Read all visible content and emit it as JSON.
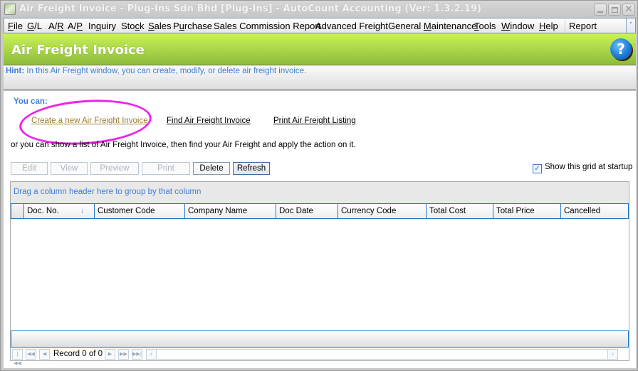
{
  "window": {
    "title": "Air Freight Invoice - Plug-Ins Sdn Bhd [Plug-Ins] - AutoCount Accounting (Ver: 1.3.2.19)",
    "controls": {
      "minimize": "_",
      "maximize": "□",
      "close": "✕"
    }
  },
  "menubar": {
    "items": [
      {
        "label": "File",
        "accel": "F"
      },
      {
        "label": "G/L",
        "accel": "G"
      },
      {
        "label": "A/R",
        "accel": "R"
      },
      {
        "label": "A/P",
        "accel": "P"
      },
      {
        "label": "Inquiry",
        "accel": "q"
      },
      {
        "label": "Stock",
        "accel": "c"
      },
      {
        "label": "Sales",
        "accel": "S"
      },
      {
        "label": "Purchase",
        "accel": "u"
      },
      {
        "label": "Sales Commission Report",
        "accel": ""
      },
      {
        "label": "Advanced Freight",
        "accel": ""
      },
      {
        "label": "General Maintenance",
        "accel": "M"
      },
      {
        "label": "Tools",
        "accel": "T"
      },
      {
        "label": "Window",
        "accel": "W"
      },
      {
        "label": "Help",
        "accel": "H"
      },
      {
        "label": "Report",
        "accel": ""
      }
    ],
    "overflow_icon": "chevron-down-icon"
  },
  "header": {
    "title": "Air Freight Invoice",
    "help_icon": "?"
  },
  "hint": {
    "label": "Hint:",
    "text": " In this Air Freight window, you can create, modify, or delete air freight invoice."
  },
  "actions": {
    "you_can": "You can:",
    "links": [
      {
        "label": "Create a new Air Freight Invoice",
        "visited": true,
        "highlighted": true
      },
      {
        "label": "Find Air Freight Invoice",
        "visited": false
      },
      {
        "label": "Print Air Freight Listing",
        "visited": false
      }
    ],
    "or_text": "or you can show a list of Air Freight Invoice, then find your Air Freight and apply the action on it."
  },
  "toolbar": {
    "buttons": [
      {
        "label": "Edit",
        "enabled": false
      },
      {
        "label": "View",
        "enabled": false
      },
      {
        "label": "Preview",
        "enabled": false
      },
      {
        "label": "Print",
        "enabled": false
      },
      {
        "label": "Delete",
        "enabled": true
      },
      {
        "label": "Refresh",
        "enabled": true,
        "focused": true
      }
    ],
    "show_grid_label": "Show this grid at startup",
    "show_grid_checked": true
  },
  "grid": {
    "group_panel_text": "Drag a column header here to group by that column",
    "columns": [
      {
        "label": "Doc. No.",
        "sorted": "descending"
      },
      {
        "label": "Customer Code"
      },
      {
        "label": "Company Name"
      },
      {
        "label": "Doc Date"
      },
      {
        "label": "Currency Code"
      },
      {
        "label": "Total Cost"
      },
      {
        "label": "Total Price"
      },
      {
        "label": "Cancelled"
      }
    ],
    "rows": [],
    "navigator": {
      "record_text": "Record 0 of 0",
      "first": "⏮",
      "prev_page": "⏪",
      "prev": "◀",
      "next": "▶",
      "next_page": "⏩",
      "last": "⏭"
    }
  }
}
